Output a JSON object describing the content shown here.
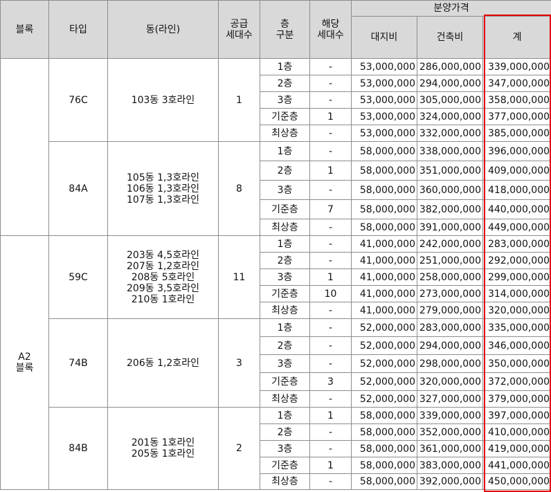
{
  "header": {
    "block": "블록",
    "type": "타입",
    "dong": "동(라인)",
    "supply": [
      "공급",
      "세대수"
    ],
    "floor": [
      "층",
      "구분"
    ],
    "units": [
      "해당",
      "세대수"
    ],
    "price_group": "분양가격",
    "land": "대지비",
    "build": "건축비",
    "total": "계"
  },
  "blocks": [
    {
      "label": "",
      "rows": 10
    },
    {
      "label": [
        "A2",
        "블록"
      ],
      "rows": 15
    }
  ],
  "groups": [
    {
      "type": "76C",
      "dongs": [
        "103동  3호라인"
      ],
      "supply": "1",
      "floors": [
        {
          "floor": "1층",
          "units": "-",
          "land": "53,000,000",
          "build": "286,000,000",
          "total": "339,000,000"
        },
        {
          "floor": "2층",
          "units": "-",
          "land": "53,000,000",
          "build": "294,000,000",
          "total": "347,000,000"
        },
        {
          "floor": "3층",
          "units": "-",
          "land": "53,000,000",
          "build": "305,000,000",
          "total": "358,000,000"
        },
        {
          "floor": "기준층",
          "units": "1",
          "land": "53,000,000",
          "build": "324,000,000",
          "total": "377,000,000"
        },
        {
          "floor": "최상층",
          "units": "-",
          "land": "53,000,000",
          "build": "332,000,000",
          "total": "385,000,000"
        }
      ]
    },
    {
      "type": "84A",
      "dongs": [
        "105동  1,3호라인",
        "106동  1,3호라인",
        "107동  1,3호라인"
      ],
      "supply": "8",
      "floors": [
        {
          "floor": "1층",
          "units": "-",
          "land": "58,000,000",
          "build": "338,000,000",
          "total": "396,000,000"
        },
        {
          "floor": "2층",
          "units": "1",
          "land": "58,000,000",
          "build": "351,000,000",
          "total": "409,000,000"
        },
        {
          "floor": "3층",
          "units": "-",
          "land": "58,000,000",
          "build": "360,000,000",
          "total": "418,000,000"
        },
        {
          "floor": "기준층",
          "units": "7",
          "land": "58,000,000",
          "build": "382,000,000",
          "total": "440,000,000"
        },
        {
          "floor": "최상층",
          "units": "-",
          "land": "58,000,000",
          "build": "391,000,000",
          "total": "449,000,000"
        }
      ]
    },
    {
      "type": "59C",
      "dongs": [
        "203동  4,5호라인",
        "207동  1,2호라인",
        "208동  5호라인",
        "209동  3,5호라인",
        "210동  1호라인"
      ],
      "supply": "11",
      "floors": [
        {
          "floor": "1층",
          "units": "-",
          "land": "41,000,000",
          "build": "242,000,000",
          "total": "283,000,000"
        },
        {
          "floor": "2층",
          "units": "-",
          "land": "41,000,000",
          "build": "251,000,000",
          "total": "292,000,000"
        },
        {
          "floor": "3층",
          "units": "1",
          "land": "41,000,000",
          "build": "258,000,000",
          "total": "299,000,000"
        },
        {
          "floor": "기준층",
          "units": "10",
          "land": "41,000,000",
          "build": "273,000,000",
          "total": "314,000,000"
        },
        {
          "floor": "최상층",
          "units": "-",
          "land": "41,000,000",
          "build": "279,000,000",
          "total": "320,000,000"
        }
      ]
    },
    {
      "type": "74B",
      "dongs": [
        "206동  1,2호라인"
      ],
      "supply": "3",
      "floors": [
        {
          "floor": "1층",
          "units": "-",
          "land": "52,000,000",
          "build": "283,000,000",
          "total": "335,000,000"
        },
        {
          "floor": "2층",
          "units": "-",
          "land": "52,000,000",
          "build": "294,000,000",
          "total": "346,000,000"
        },
        {
          "floor": "3층",
          "units": "-",
          "land": "52,000,000",
          "build": "298,000,000",
          "total": "350,000,000"
        },
        {
          "floor": "기준층",
          "units": "3",
          "land": "52,000,000",
          "build": "320,000,000",
          "total": "372,000,000"
        },
        {
          "floor": "최상층",
          "units": "-",
          "land": "52,000,000",
          "build": "327,000,000",
          "total": "379,000,000"
        }
      ]
    },
    {
      "type": "84B",
      "dongs": [
        "201동  1호라인",
        "205동  1호라인"
      ],
      "supply": "2",
      "floors": [
        {
          "floor": "1층",
          "units": "1",
          "land": "58,000,000",
          "build": "339,000,000",
          "total": "397,000,000"
        },
        {
          "floor": "2층",
          "units": "-",
          "land": "58,000,000",
          "build": "352,000,000",
          "total": "410,000,000"
        },
        {
          "floor": "3층",
          "units": "-",
          "land": "58,000,000",
          "build": "361,000,000",
          "total": "419,000,000"
        },
        {
          "floor": "기준층",
          "units": "1",
          "land": "58,000,000",
          "build": "383,000,000",
          "total": "441,000,000"
        },
        {
          "floor": "최상층",
          "units": "-",
          "land": "58,000,000",
          "build": "392,000,000",
          "total": "450,000,000"
        }
      ]
    }
  ],
  "highlight": {
    "column": "total",
    "color": "#e60000"
  }
}
